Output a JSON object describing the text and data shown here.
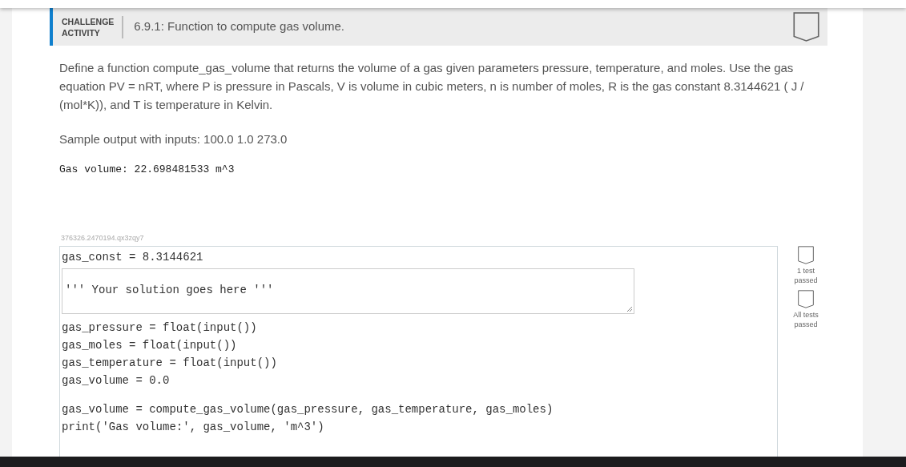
{
  "header": {
    "tag_lines": [
      "CHALLENGE",
      "ACTIVITY"
    ],
    "title": "6.9.1: Function to compute gas volume."
  },
  "description": "Define a function compute_gas_volume that returns the volume of a gas given parameters pressure, temperature, and moles. Use the gas equation PV = nRT, where P is pressure in Pascals, V is volume in cubic meters, n is number of moles, R is the gas constant 8.3144621 ( J / (mol*K)), and T is temperature in Kelvin.",
  "sample_label": "Sample output with inputs: 100.0 1.0 273.0",
  "sample_output": "Gas volume: 22.698481533 m^3",
  "activity_id": "376326.2470194.qx3zqy7",
  "code_before": [
    "gas_const = 8.3144621"
  ],
  "solution": "''' Your solution goes here '''",
  "code_after": [
    [
      "gas_pressure = float(input())",
      "gas_moles = float(input())",
      "gas_temperature = float(input())",
      "gas_volume = 0.0"
    ],
    [
      "gas_volume = compute_gas_volume(gas_pressure, gas_temperature, gas_moles)",
      "print('Gas volume:', gas_volume, 'm^3')"
    ]
  ],
  "tests": [
    {
      "label": "1 test passed",
      "passed": false
    },
    {
      "label": "All tests passed",
      "passed": false
    }
  ]
}
